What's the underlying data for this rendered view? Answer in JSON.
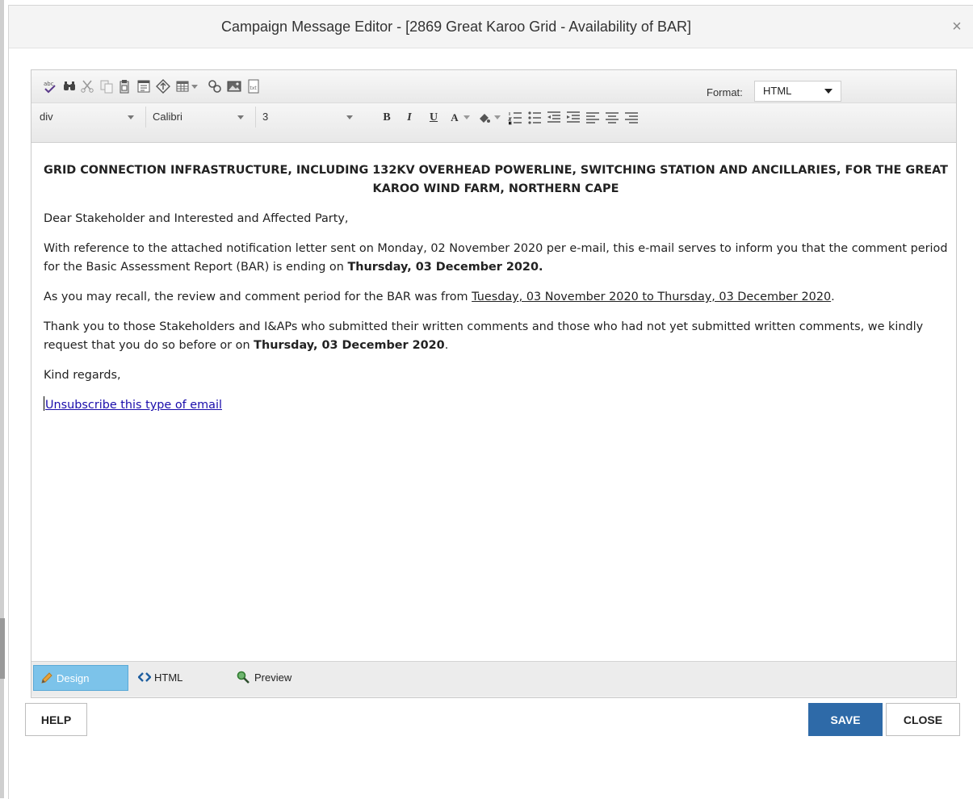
{
  "dialog": {
    "title": "Campaign Message Editor - [2869 Great Karoo Grid - Availability of BAR]",
    "close_glyph": "×"
  },
  "toolbar": {
    "icons": [
      "spellcheck-icon",
      "find-icon",
      "cut-icon",
      "copy-icon",
      "paste-icon",
      "paste-special-icon",
      "insert-link-icon",
      "table-icon",
      "document-manager-icon",
      "image-manager-icon",
      "template-icon"
    ],
    "format_label": "Format:",
    "format_value": "HTML",
    "block_value": "div",
    "font_value": "Calibri",
    "size_value": "3",
    "bold": "B",
    "italic": "I",
    "underline": "U",
    "fore_color": "A"
  },
  "document": {
    "heading": "GRID CONNECTION INFRASTRUCTURE, INCLUDING 132KV OVERHEAD POWERLINE, SWITCHING STATION AND ANCILLARIES, FOR THE GREAT KAROO WIND FARM, NORTHERN CAPE",
    "greeting": "Dear Stakeholder and Interested and Affected Party,",
    "p1_text": "With reference to the attached notification letter sent on Monday, 02 November 2020 per e-mail, this e-mail serves to inform you that the comment period for the Basic Assessment Report (BAR) is ending on ",
    "p1_bold": "Thursday, 03 December 2020.",
    "p2_text": "As you may recall, the review and comment period for the BAR was from ",
    "p2_underline": "Tuesday, 03 November 2020 to Thursday, 03 December 2020",
    "p2_end": ".",
    "p3_text": "Thank you to those Stakeholders and I&APs who submitted their written comments and those who had not yet submitted written comments, we kindly request that you do so before or on ",
    "p3_bold": "Thursday, 03 December 2020",
    "p3_end": ".",
    "closing": "Kind regards,",
    "unsubscribe": "Unsubscribe this type of email"
  },
  "modes": {
    "design": "Design",
    "html": "HTML",
    "preview": "Preview"
  },
  "buttons": {
    "help": "HELP",
    "save": "SAVE",
    "close": "CLOSE"
  },
  "colors": {
    "accent": "#2e6aa8",
    "active_mode": "#7cc3ea",
    "link": "#1a0dab"
  }
}
